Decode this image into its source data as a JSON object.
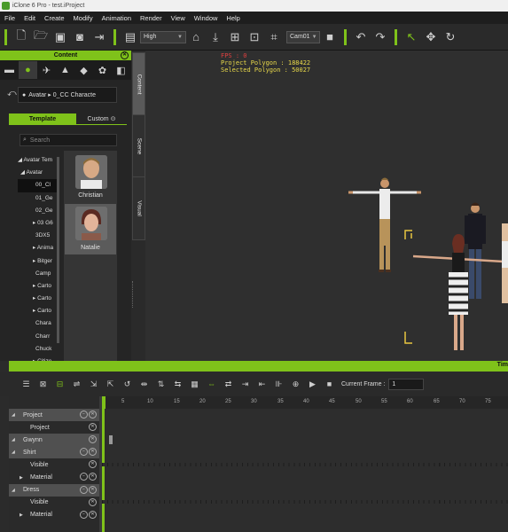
{
  "window": {
    "title": "iClone 6 Pro - test.iProject"
  },
  "menu": [
    "File",
    "Edit",
    "Create",
    "Modify",
    "Animation",
    "Render",
    "View",
    "Window",
    "Help"
  ],
  "toolbar": {
    "quality": "High",
    "camera": "Cam01"
  },
  "content_panel": {
    "title": "Content",
    "path": "Avatar ▸ 0_CC Characte",
    "template_tab": "Template",
    "custom_tab": "Custom",
    "search_placeholder": "Search",
    "tree": [
      "◢ Avatar Tem",
      "◢ Avatar",
      "00_Cl",
      "01_Ge",
      "02_Ge",
      "▸ 03 G6",
      "3DX5",
      "▸ Anima",
      "▸ Bitger",
      "Camp",
      "▸ Carto",
      "▸ Carto",
      "▸ Carto",
      "Chara",
      "Charr",
      "Chuck",
      "▸ Citize"
    ],
    "thumbnails": [
      {
        "name": "Christian"
      },
      {
        "name": "Natalie"
      }
    ]
  },
  "side_tabs": [
    "Content",
    "Scene",
    "Visual"
  ],
  "viewport": {
    "fps": "FPS : 0",
    "project_polygon": "Project Polygon : 188422",
    "selected_polygon": "Selected Polygon : 50027"
  },
  "timeline": {
    "label": "Tim",
    "current_frame_label": "Current Frame :",
    "current_frame": "1",
    "ruler": [
      "5",
      "10",
      "15",
      "20",
      "25",
      "30",
      "35",
      "40",
      "45",
      "50",
      "55",
      "60",
      "65",
      "70",
      "75"
    ],
    "tracks": [
      {
        "label": "Project",
        "group": true,
        "expanded": true
      },
      {
        "label": "Project",
        "group": false
      },
      {
        "label": "Gwynn",
        "group": true,
        "expanded": true
      },
      {
        "label": "Shirt",
        "group": true,
        "expanded": true
      },
      {
        "label": "Visible",
        "group": false
      },
      {
        "label": "Material",
        "group": false,
        "collapsed": true
      },
      {
        "label": "Dress",
        "group": true,
        "expanded": true
      },
      {
        "label": "Visible",
        "group": false
      },
      {
        "label": "Material",
        "group": false,
        "collapsed": true
      }
    ]
  },
  "colors": {
    "accent": "#7fc21a",
    "fps": "#e04040",
    "stats": "#e8d84a"
  }
}
